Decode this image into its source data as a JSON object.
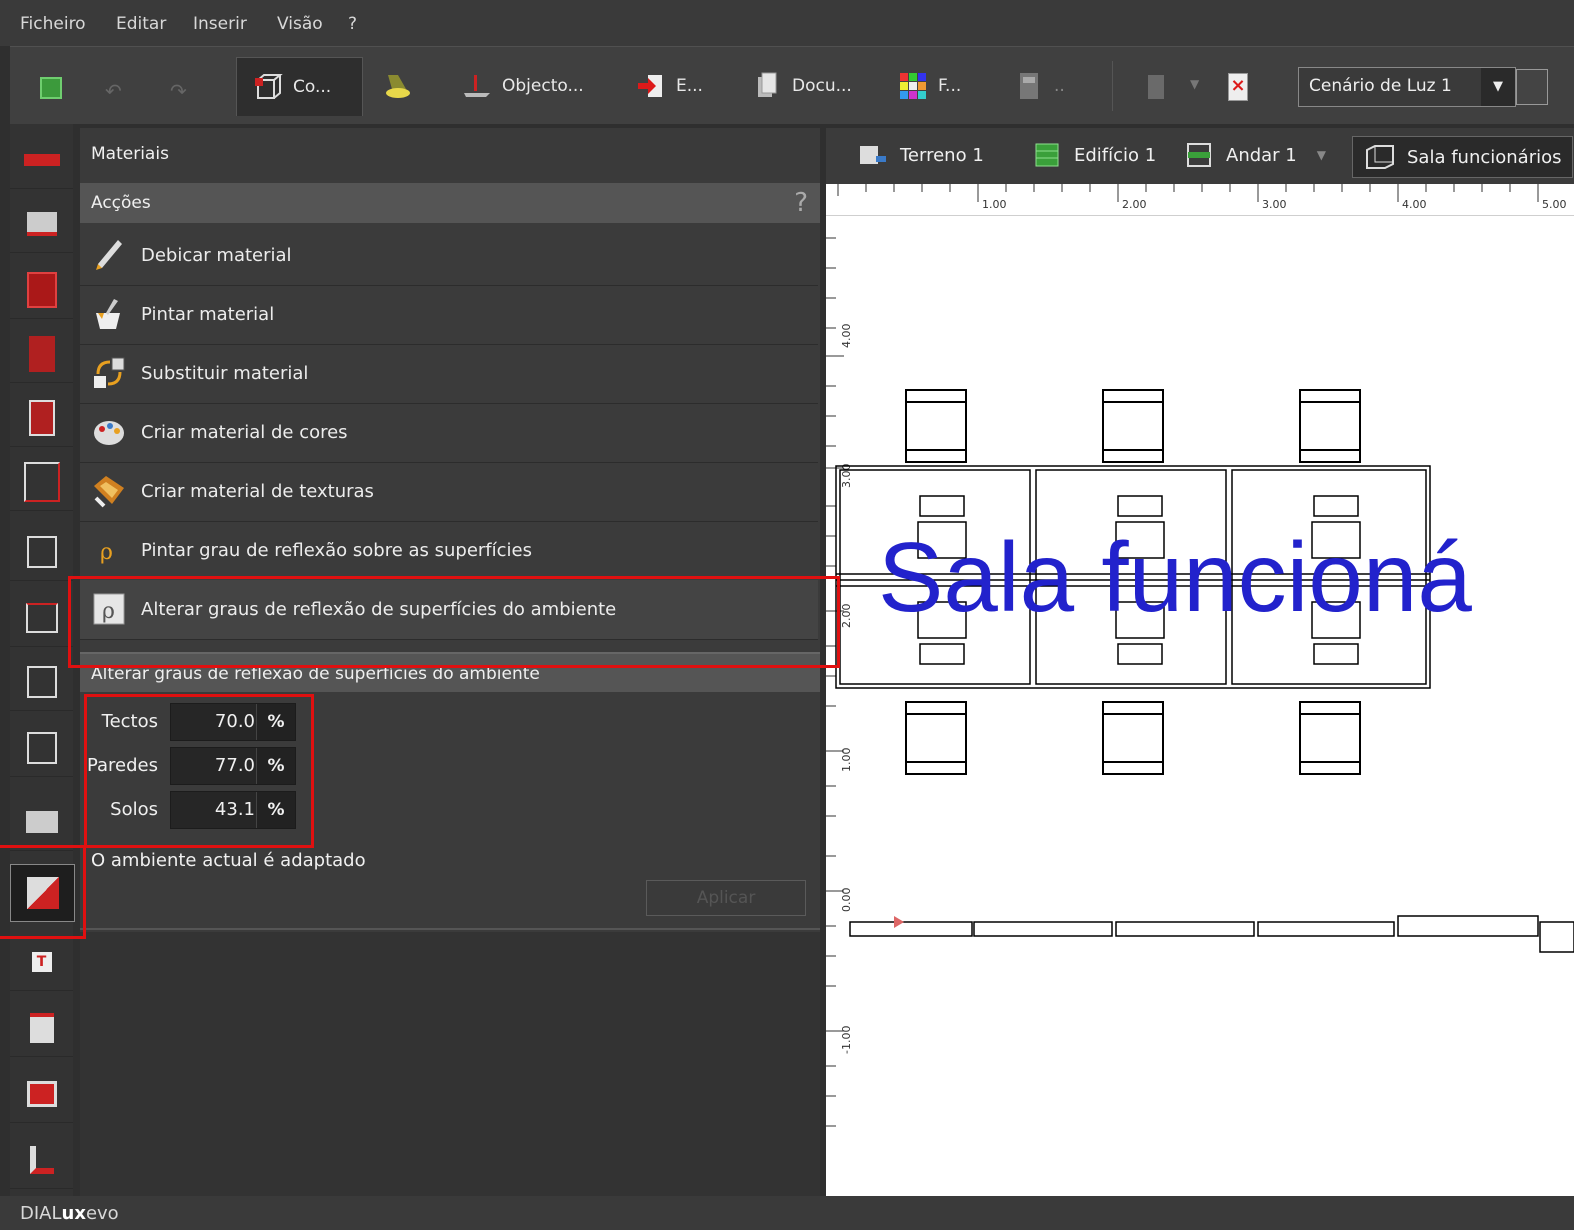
{
  "menubar": {
    "items": [
      "Ficheiro",
      "Editar",
      "Inserir",
      "Visão",
      "?"
    ]
  },
  "toolbar": {
    "items": [
      {
        "label": "Co...",
        "icon": "construction-icon"
      },
      {
        "label": "",
        "icon": "light-icon"
      },
      {
        "label": "Objecto...",
        "icon": "objects-icon"
      },
      {
        "label": "E...",
        "icon": "export-icon"
      },
      {
        "label": "Docu...",
        "icon": "documentation-icon"
      },
      {
        "label": "F...",
        "icon": "grid-icon"
      },
      {
        "label": "..",
        "icon": "calculator-icon"
      }
    ],
    "light_scene": "Cenário de Luz 1"
  },
  "panel": {
    "title": "Materiais",
    "actions_header": "Acções",
    "help": "?",
    "actions": [
      {
        "label": "Debicar material",
        "icon": "pipette-icon"
      },
      {
        "label": "Pintar material",
        "icon": "paint-bucket-icon"
      },
      {
        "label": "Substituir material",
        "icon": "replace-material-icon"
      },
      {
        "label": "Criar material de cores",
        "icon": "palette-icon"
      },
      {
        "label": "Criar material de texturas",
        "icon": "texture-icon"
      },
      {
        "label": "Pintar grau de reflexão sobre as superfícies",
        "icon": "reflection-rho-icon"
      },
      {
        "label": "Alterar graus de reflexão de superfícies do ambiente",
        "icon": "reflection-room-icon"
      }
    ],
    "section_title": "Alterar graus de reflexão de superfícies do ambiente",
    "fields": [
      {
        "label": "Tectos",
        "value": "70.0",
        "unit": "%"
      },
      {
        "label": "Paredes",
        "value": "77.0",
        "unit": "%"
      },
      {
        "label": "Solos",
        "value": "43.1",
        "unit": "%"
      }
    ],
    "status": "O ambiente actual é adaptado",
    "apply_label": "Aplicar"
  },
  "view": {
    "breadcrumb": [
      {
        "label": "Terreno 1",
        "icon": "terrain-icon"
      },
      {
        "label": "Edifício 1",
        "icon": "building-icon"
      },
      {
        "label": "Andar 1",
        "icon": "storey-icon"
      },
      {
        "label": "Sala funcionários",
        "icon": "room-icon"
      }
    ],
    "ruler_x": [
      "1.00",
      "2.00",
      "3.00",
      "4.00",
      "5.00"
    ],
    "ruler_y": [
      "4.00",
      "3.00",
      "2.00",
      "1.00",
      "0.00",
      "-1.00"
    ],
    "room_label": "Sala funcioná"
  },
  "statusbar": {
    "brand_a": "DIAL",
    "brand_b": "ux",
    "brand_c": "evo"
  },
  "colors": {
    "highlight": "#e01010",
    "room_label": "#2222cc",
    "accent_red": "#cc2222"
  }
}
